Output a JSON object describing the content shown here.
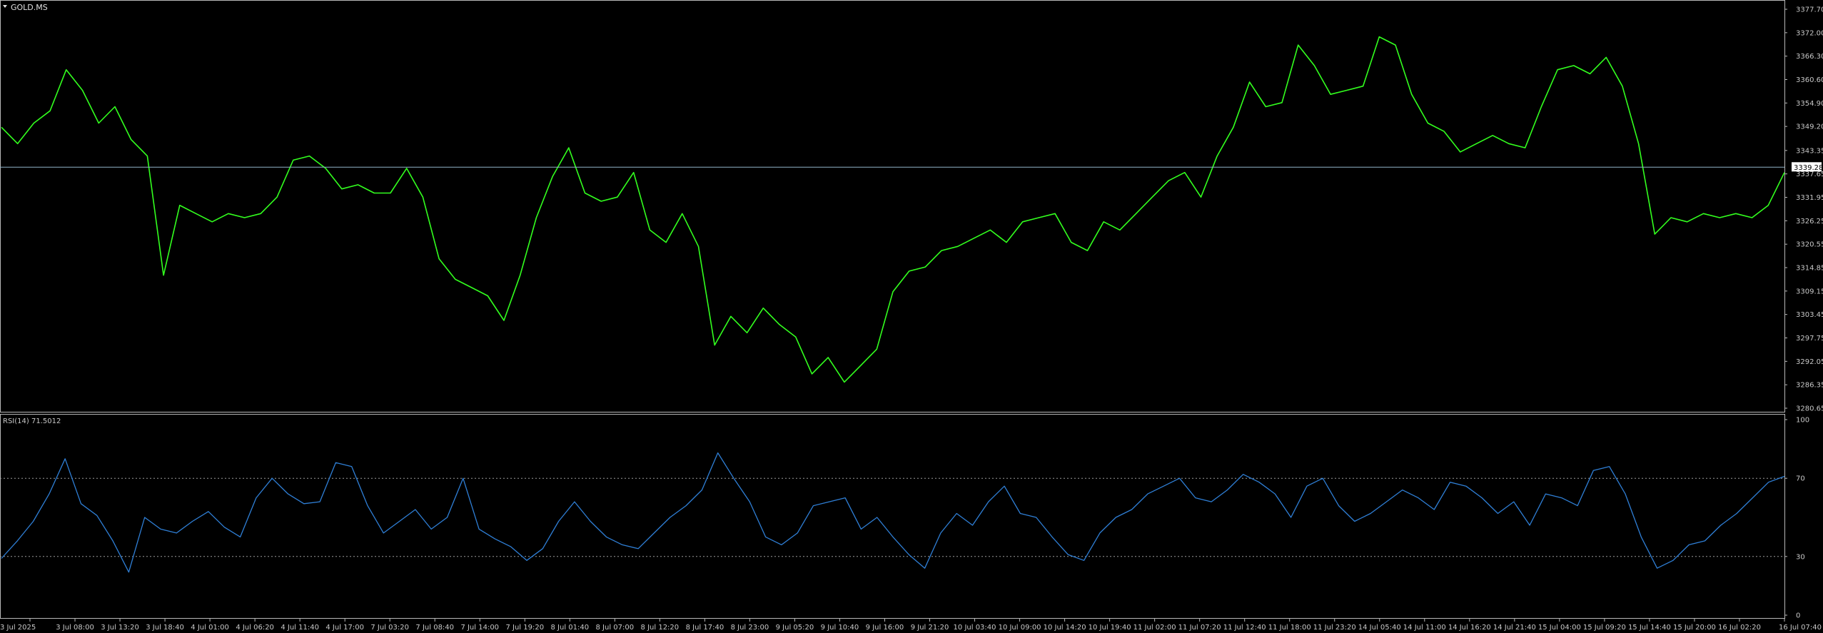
{
  "chart_data": [
    {
      "type": "line",
      "instrument": "GOLD.MS",
      "symbol_label": "GOLD.MS",
      "colors": {
        "price": "#32ff1e",
        "background": "#000000",
        "current_line": "#8fb3c8",
        "axis": "#c8c8c8"
      },
      "y_ticks": [
        "3377.70",
        "3372.00",
        "3366.30",
        "3360.60",
        "3354.90",
        "3349.20",
        "3343.35",
        "3337.65",
        "3331.95",
        "3326.25",
        "3320.55",
        "3314.85",
        "3309.15",
        "3303.45",
        "3297.75",
        "3292.05",
        "3286.35",
        "3280.65"
      ],
      "ylim": [
        3280.65,
        3377.7
      ],
      "current_price": 3339.28,
      "current_price_label": "3339.28",
      "x_ticks": [
        "3 Jul 2025",
        "3 Jul 08:00",
        "3 Jul 13:20",
        "3 Jul 18:40",
        "4 Jul 01:00",
        "4 Jul 06:20",
        "4 Jul 11:40",
        "4 Jul 17:00",
        "7 Jul 03:20",
        "7 Jul 08:40",
        "7 Jul 14:00",
        "7 Jul 19:20",
        "8 Jul 01:40",
        "8 Jul 07:00",
        "8 Jul 12:20",
        "8 Jul 17:40",
        "8 Jul 23:00",
        "9 Jul 05:20",
        "9 Jul 10:40",
        "9 Jul 16:00",
        "9 Jul 21:20",
        "10 Jul 03:40",
        "10 Jul 09:00",
        "10 Jul 14:20",
        "10 Jul 19:40",
        "11 Jul 02:00",
        "11 Jul 07:20",
        "11 Jul 12:40",
        "11 Jul 18:00",
        "11 Jul 23:20",
        "14 Jul 05:40",
        "14 Jul 11:00",
        "14 Jul 16:20",
        "14 Jul 21:40",
        "15 Jul 04:00",
        "15 Jul 09:20",
        "15 Jul 14:40",
        "15 Jul 20:00",
        "16 Jul 02:20",
        "16 Jul 07:40"
      ],
      "series": [
        {
          "values": [
            3349,
            3345,
            3350,
            3353,
            3363,
            3358,
            3350,
            3354,
            3346,
            3342,
            3313,
            3330,
            3328,
            3326,
            3328,
            3327,
            3328,
            3332,
            3341,
            3342,
            3339,
            3334,
            3335,
            3333,
            3333,
            3339,
            3332,
            3317,
            3312,
            3310,
            3308,
            3302,
            3313,
            3327,
            3337,
            3344,
            3333,
            3331,
            3332,
            3338,
            3324,
            3321,
            3328,
            3320,
            3296,
            3303,
            3299,
            3305,
            3301,
            3298,
            3289,
            3293,
            3287,
            3291,
            3295,
            3309,
            3314,
            3315,
            3319,
            3320,
            3322,
            3324,
            3321,
            3326,
            3327,
            3328,
            3321,
            3319,
            3326,
            3324,
            3328,
            3332,
            3336,
            3338,
            3332,
            3342,
            3349,
            3360,
            3354,
            3355,
            3369,
            3364,
            3357,
            3358,
            3359,
            3371,
            3369,
            3357,
            3350,
            3348,
            3343,
            3345,
            3347,
            3345,
            3344,
            3354,
            3363,
            3364,
            3362,
            3366,
            3359,
            3345,
            3323,
            3327,
            3326,
            3328,
            3327,
            3328,
            3327,
            3330,
            3338
          ]
        }
      ]
    },
    {
      "type": "line",
      "title": "RSI(14) 71.5012",
      "colors": {
        "rsi": "#2f7fd6",
        "levels": "#9a9a9a"
      },
      "ylim": [
        0,
        100
      ],
      "levels": [
        70,
        30
      ],
      "y_ticks": [
        "100",
        "70",
        "30",
        "0"
      ],
      "series": [
        {
          "values": [
            29,
            38,
            48,
            62,
            80,
            57,
            51,
            38,
            22,
            50,
            44,
            42,
            48,
            53,
            45,
            40,
            60,
            70,
            62,
            57,
            58,
            78,
            76,
            56,
            42,
            48,
            54,
            44,
            50,
            70,
            44,
            39,
            35,
            28,
            34,
            48,
            58,
            48,
            40,
            36,
            34,
            42,
            50,
            56,
            64,
            83,
            70,
            58,
            40,
            36,
            42,
            56,
            58,
            60,
            44,
            50,
            40,
            31,
            24,
            42,
            52,
            46,
            58,
            66,
            52,
            50,
            40,
            31,
            28,
            42,
            50,
            54,
            62,
            66,
            70,
            60,
            58,
            64,
            72,
            68,
            62,
            50,
            66,
            70,
            56,
            48,
            52,
            58,
            64,
            60,
            54,
            68,
            66,
            60,
            52,
            58,
            46,
            62,
            60,
            56,
            74,
            76,
            62,
            40,
            24,
            28,
            36,
            38,
            46,
            52,
            60,
            68,
            71
          ]
        }
      ]
    }
  ]
}
